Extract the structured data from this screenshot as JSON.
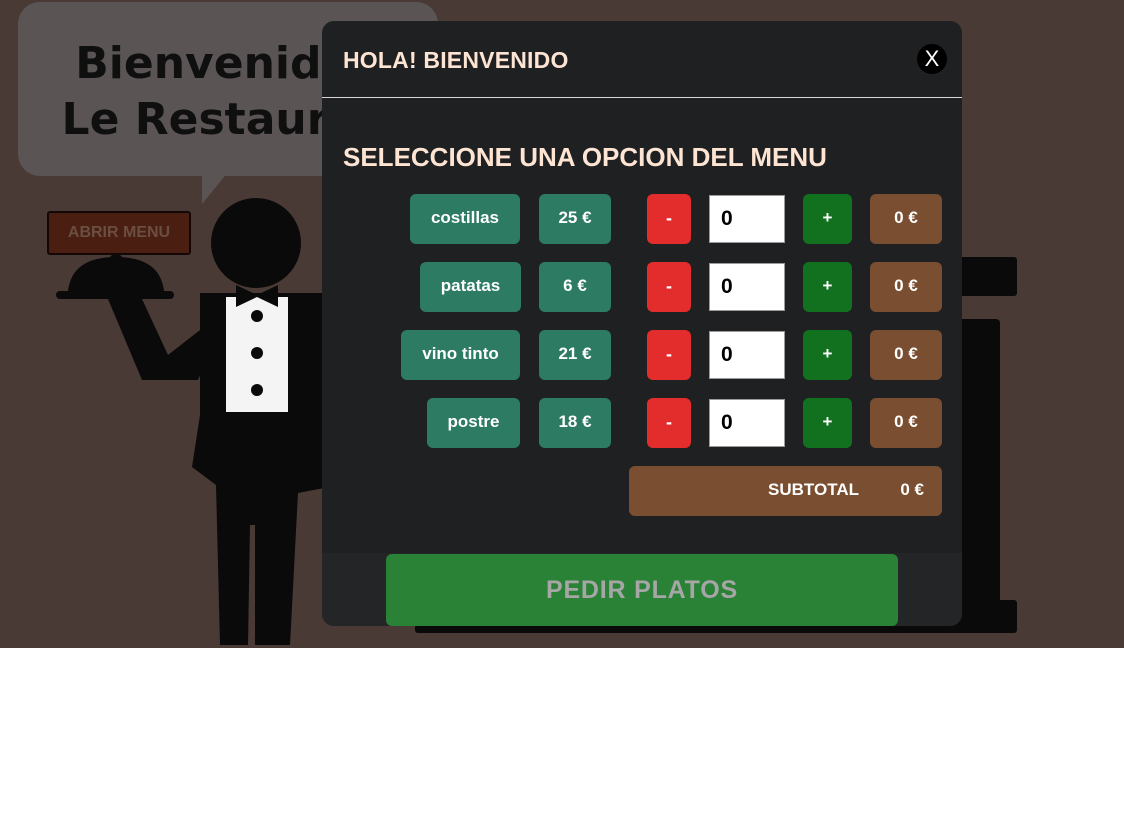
{
  "background": {
    "welcome_line1": "Bienvenido a",
    "welcome_line2": "Le Restaurant",
    "open_menu_label": "ABRIR MENU"
  },
  "modal": {
    "title": "HOLA! BIENVENIDO",
    "close_label": "X",
    "section_title": "SELECCIONE UNA OPCION DEL MENU",
    "items": [
      {
        "name": "costillas",
        "price": "25 €",
        "minus": "-",
        "qty": "0",
        "plus": "+",
        "total": "0 €"
      },
      {
        "name": "patatas",
        "price": "6 €",
        "minus": "-",
        "qty": "0",
        "plus": "+",
        "total": "0 €"
      },
      {
        "name": "vino tinto",
        "price": "21 €",
        "minus": "-",
        "qty": "0",
        "plus": "+",
        "total": "0 €"
      },
      {
        "name": "postre",
        "price": "18 €",
        "minus": "-",
        "qty": "0",
        "plus": "+",
        "total": "0 €"
      }
    ],
    "subtotal_label": "SUBTOTAL",
    "subtotal_value": "0 €",
    "order_button": "PEDIR PLATOS"
  },
  "colors": {
    "backdrop": "#4a3a35",
    "modal_bg": "#1f2022",
    "item_green": "#2e7b63",
    "minus_red": "#e32c2c",
    "plus_green": "#11711f",
    "total_brown": "#7a4e30",
    "order_green": "#2a8237",
    "heading_peach": "#fde4d3"
  },
  "icons": [
    "waiter-illustration",
    "cloche-icon",
    "speech-bubble"
  ]
}
